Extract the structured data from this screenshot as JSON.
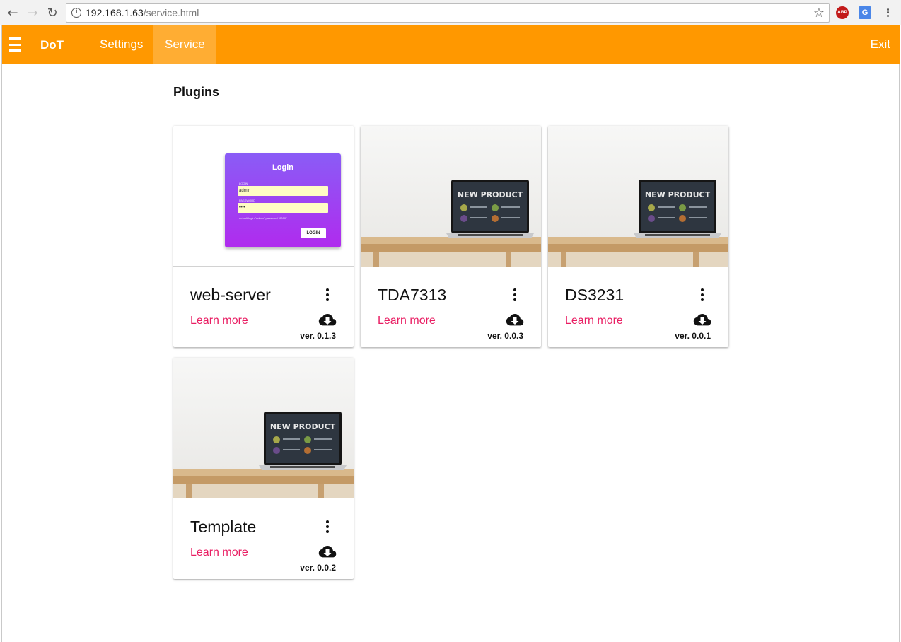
{
  "browser": {
    "url_host": "192.168.1.63",
    "url_path": "/service.html",
    "ext_abp": "ABP",
    "ext_translate": "G"
  },
  "appbar": {
    "brand": "DoT",
    "nav": [
      {
        "label": "Settings"
      },
      {
        "label": "Service",
        "active": true
      }
    ],
    "exit_label": "Exit",
    "accent": "#ff9800",
    "active_tab_color": "#ffad33"
  },
  "page": {
    "title": "Plugins"
  },
  "plugins": [
    {
      "name": "web-server",
      "learn_more": "Learn more",
      "version": "ver. 0.1.3",
      "image": "login-form"
    },
    {
      "name": "TDA7313",
      "learn_more": "Learn more",
      "version": "ver. 0.0.3",
      "image": "laptop-new-product"
    },
    {
      "name": "DS3231",
      "learn_more": "Learn more",
      "version": "ver. 0.0.1",
      "image": "laptop-new-product"
    },
    {
      "name": "Template",
      "learn_more": "Learn more",
      "version": "ver. 0.0.2",
      "image": "laptop-new-product"
    }
  ],
  "login_preview": {
    "title": "Login",
    "login_label": "LOGIN",
    "login_value": "admin",
    "password_label": "PASSWORD",
    "password_value": "••••",
    "hint": "default login \"admin\" password \"0000\"",
    "button": "LOGIN"
  },
  "laptop_screen_title": "NEW PRODUCT",
  "link_color": "#e91e63"
}
